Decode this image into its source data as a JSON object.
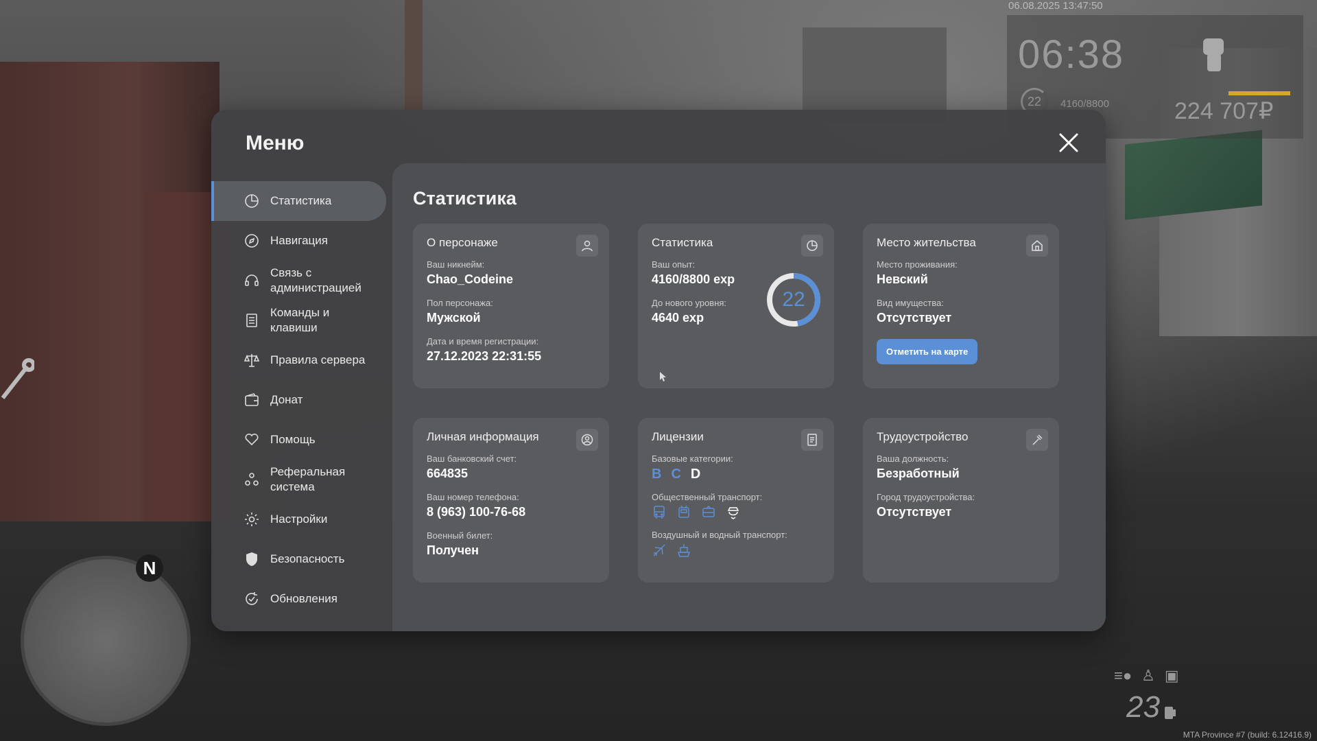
{
  "hud": {
    "timestamp": "06.08.2025 13:47:50",
    "clock": "06:38",
    "level": "22",
    "exp": "4160/8800",
    "money": "224 707₽",
    "speed": "23",
    "build": "MTA Province #7 (build: 6.12416.9)",
    "compass": "N"
  },
  "menu": {
    "title": "Меню",
    "sidebar": [
      {
        "label": "Статистика",
        "icon": "chart-pie-icon",
        "active": true
      },
      {
        "label": "Навигация",
        "icon": "compass-icon"
      },
      {
        "label": "Связь с\nадминистрацией",
        "icon": "headset-icon"
      },
      {
        "label": "Команды и\nклавиши",
        "icon": "keyboard-doc-icon"
      },
      {
        "label": "Правила сервера",
        "icon": "scales-icon"
      },
      {
        "label": "Донат",
        "icon": "wallet-icon"
      },
      {
        "label": "Помощь",
        "icon": "heart-hand-icon"
      },
      {
        "label": "Реферальная\nсистема",
        "icon": "people-icon"
      },
      {
        "label": "Настройки",
        "icon": "gear-icon"
      },
      {
        "label": "Безопасность",
        "icon": "shield-icon"
      },
      {
        "label": "Обновления",
        "icon": "refresh-check-icon"
      }
    ]
  },
  "content": {
    "title": "Статистика",
    "about": {
      "title": "О персонаже",
      "nick_label": "Ваш никнейм:",
      "nick": "Chao_Codeine",
      "gender_label": "Пол персонажа:",
      "gender": "Мужской",
      "reg_label": "Дата и время регистрации:",
      "reg": "27.12.2023 22:31:55"
    },
    "stats": {
      "title": "Статистика",
      "exp_label": "Ваш опыт:",
      "exp": "4160/8800 exp",
      "next_label": "До нового уровня:",
      "next": "4640 exp",
      "level": "22",
      "progress": 0.4727
    },
    "residence": {
      "title": "Место жительства",
      "place_label": "Место проживания:",
      "place": "Невский",
      "property_label": "Вид имущества:",
      "property": "Отсутствует",
      "map_button": "Отметить на карте"
    },
    "personal": {
      "title": "Личная информация",
      "bank_label": "Ваш банковский счет:",
      "bank": "664835",
      "phone_label": "Ваш номер телефона:",
      "phone": "8 (963) 100-76-68",
      "military_label": "Военный билет:",
      "military": "Получен"
    },
    "licenses": {
      "title": "Лицензии",
      "base_label": "Базовые категории:",
      "categories": [
        {
          "letter": "B",
          "color": "#5b8fd6"
        },
        {
          "letter": "C",
          "color": "#5b8fd6"
        },
        {
          "letter": "D",
          "color": "#ffffff"
        }
      ],
      "public_label": "Общественный транспорт:",
      "public_icons": [
        "bus-icon",
        "trolleybus-icon",
        "tram-icon",
        "taxi-icon"
      ],
      "air_label": "Воздушный и водный транспорт:",
      "air_icons": [
        "plane-icon",
        "boat-icon"
      ]
    },
    "employment": {
      "title": "Трудоустройство",
      "position_label": "Ваша должность:",
      "position": "Безработный",
      "city_label": "Город трудоустройства:",
      "city": "Отсутствует"
    }
  }
}
